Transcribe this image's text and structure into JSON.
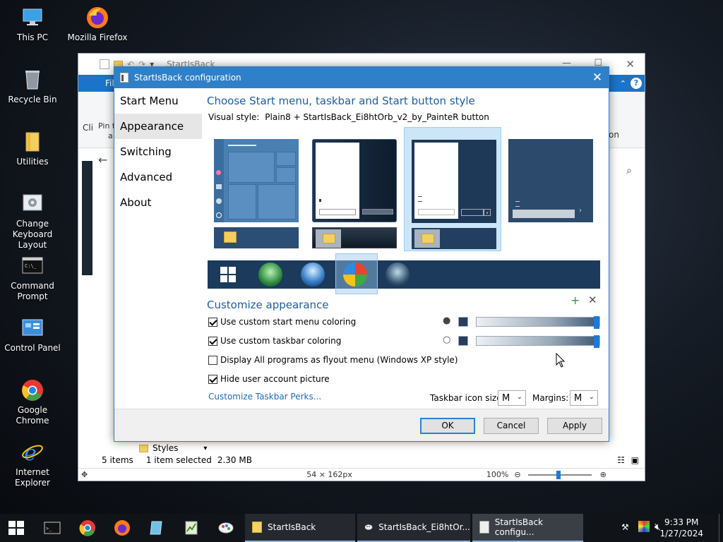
{
  "desktop": {
    "icons": [
      {
        "label": "This PC"
      },
      {
        "label": "Mozilla Firefox"
      },
      {
        "label": "Recycle Bin"
      },
      {
        "label": "Utilities"
      },
      {
        "label": "Change Keyboard Layout"
      },
      {
        "label": "Command Prompt"
      },
      {
        "label": "Control Panel"
      },
      {
        "label": "Google Chrome"
      },
      {
        "label": "Internet Explorer"
      }
    ]
  },
  "explorer": {
    "title": "StartIsBack",
    "ribbon_tab": "Fil",
    "ribbon_left1": "Cli",
    "ribbon_left2a": "Pin t",
    "ribbon_left2b": "a",
    "ribbon_right": "on",
    "status_items": "5 items",
    "status_selected": "1 item selected",
    "status_size": "2.30 MB",
    "folder_label": "Styles",
    "dims": "54 × 162px",
    "zoom": "100%"
  },
  "dialog": {
    "title": "StartIsBack configuration",
    "sidebar": {
      "items": [
        {
          "label": "Start Menu"
        },
        {
          "label": "Appearance"
        },
        {
          "label": "Switching"
        },
        {
          "label": "Advanced"
        },
        {
          "label": "About"
        }
      ]
    },
    "heading": "Choose Start menu, taskbar and Start button style",
    "visual_style_label": "Visual style:",
    "visual_style_value": "Plain8 + StartIsBack_Ei8htOrb_v2_by_PainteR button",
    "customize_heading": "Customize appearance",
    "options": [
      {
        "label": "Use custom start menu coloring",
        "checked": true
      },
      {
        "label": "Use custom taskbar coloring",
        "checked": true
      },
      {
        "label": "Display All programs as flyout menu (Windows XP style)",
        "checked": false
      },
      {
        "label": "Hide user account picture",
        "checked": true
      }
    ],
    "link": "Customize Taskbar Perks...",
    "taskbar_icon_size_label": "Taskbar icon size:",
    "taskbar_icon_size_value": "M",
    "margins_label": "Margins:",
    "margins_value": "M",
    "buttons": {
      "ok": "OK",
      "cancel": "Cancel",
      "apply": "Apply"
    },
    "sliders": {
      "start_menu": 0.98,
      "taskbar": 0.98
    }
  },
  "taskbar": {
    "apps": [
      {
        "label": "StartIsBack"
      },
      {
        "label": "StartIsBack_Ei8htOr..."
      },
      {
        "label": "StartIsBack configu..."
      }
    ],
    "time": "9:33 PM",
    "date": "1/27/2024"
  }
}
